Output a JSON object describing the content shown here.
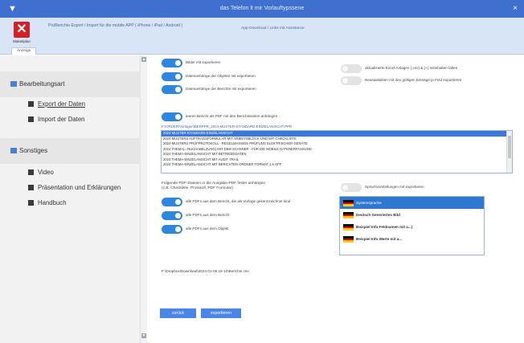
{
  "window": {
    "title": "das Telefon lt mir Vorlauftypssene",
    "close_glyph": "×"
  },
  "ribbon": {
    "exit_label": "Maketiplan",
    "info_text": "PrüBerichte Export / Import für die mobile APP ( iPhone / iPad / Android )",
    "link_text": "App-Download / Links mit Assistance",
    "subtab_label": "Anzeige"
  },
  "sidebar": {
    "sections": [
      {
        "label": "Bearbeitungsart",
        "items": [
          {
            "label": "Export der Daten",
            "icon": "document-icon"
          },
          {
            "label": "Import der Daten",
            "icon": "document-icon"
          }
        ]
      },
      {
        "label": "Sonstiges",
        "items": [
          {
            "label": "Video",
            "icon": "video-icon"
          },
          {
            "label": "Präsentation und Erklärungen",
            "icon": "presentation-icon"
          },
          {
            "label": "Handbuch",
            "icon": "book-icon"
          }
        ]
      }
    ]
  },
  "options": {
    "toggles": [
      {
        "label": "Bilder mit exportieren",
        "on": true
      },
      {
        "label": "Datenanhänge der Objekte mit exportieren",
        "on": true
      },
      {
        "label": "Datenanhänge der Berichte mit exportieren",
        "on": true
      },
      {
        "label": "aktualisierte Excel-Anlagen (.csv) & (+) mitinhalten falten",
        "on": false
      },
      {
        "label": "Neustatistiken mit den gültigen Einträge je Feld exportieren",
        "on": false
      },
      {
        "label": "leeren Bericht als PDF mit den Berichtsseiten anhängen",
        "on": true
      },
      {
        "label": "Sprachvorstellungen mit exportieren",
        "on": false
      },
      {
        "label": "alle PDFs aus dem Bericht, die als Vorlage gekennzeichnet sind",
        "on": true
      },
      {
        "label": "alle PDFs aus dem Bericht",
        "on": true
      },
      {
        "label": "alle PDFs aus dem Objekt",
        "on": true
      }
    ]
  },
  "template_path": "F:\\ORDER\\Vorlagen\\BERPPR_2024-MUSTER-STANDARD-EINZELANSICHT.PPR",
  "template_list": [
    {
      "text": "2024-MUSTER-STANDARD-EINZELANSICHT",
      "selected": true
    },
    {
      "text": "2024-MUSTERS AUFTRAGSFORMULAR MIT ARBEITSBLOCK UND MIT CHECKLISTE",
      "selected": false
    },
    {
      "text": "2024-MUSTERS PRÜFPROTOKOLL - REGELMASSIGE PRÜFUNG ELEKTRISCHER GERÄTE",
      "selected": false
    },
    {
      "text": "2024 THEMA(= RUCHABELZUNG) MIT DEM SCANNER - FÜR DIE MOBILE DATENERFASSUNG",
      "selected": false
    },
    {
      "text": "2024 THEMA-EINZELANSICHT MIT BETRIEBSDATEN",
      "selected": false
    },
    {
      "text": "2024 THEMA-EINZELANSICHT MIT AUDIT TRAIL",
      "selected": false
    },
    {
      "text": "2024 THEMA-EINZELANSICHT MIT BERICHTEN ORDNER FORMAT 1.6 OFF",
      "selected": false
    }
  ],
  "pdf_attach_text_1": "Folgende PDF-Dateien in die Ausgabe-PDF fester anhängen",
  "pdf_attach_text_2": "(z.B. Checkliste, Protokoll, PDF Formular)",
  "languages": [
    {
      "label": "Systemsprache",
      "selected": true
    },
    {
      "label": "Deutsch Generiertes Bild",
      "selected": false
    },
    {
      "label": "Beispiel Info Feldnamen mit a...)",
      "selected": false
    },
    {
      "label": "Beispiel Info Werte mit a...",
      "selected": false
    }
  ],
  "status_text": "F:\\Dropbox\\Download\\2024-01-08 15-10\\Berichte.csv",
  "buttons": {
    "back": "zurück",
    "export": "exportieren"
  },
  "colors": {
    "titlebar": "#3f6fcf",
    "accent": "#2e86de",
    "selection": "#3c78d8",
    "exit_red": "#d41f26"
  }
}
